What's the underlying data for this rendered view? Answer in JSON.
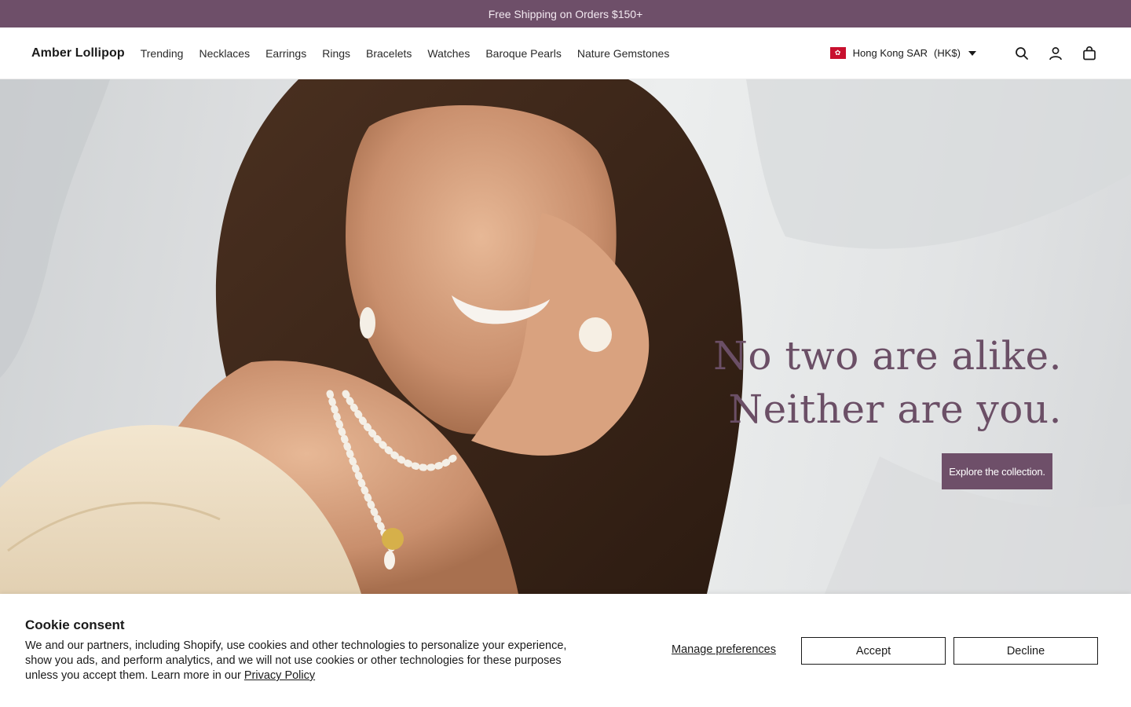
{
  "announcement": {
    "text": "Free Shipping on Orders $150+"
  },
  "header": {
    "logo": "Amber Lollipop",
    "nav": [
      "Trending",
      "Necklaces",
      "Earrings",
      "Rings",
      "Bracelets",
      "Watches",
      "Baroque Pearls",
      "Nature Gemstones"
    ],
    "locale": {
      "region": "Hong Kong SAR",
      "currency": "(HK$)",
      "flag_icon": "hong-kong-flag-icon"
    },
    "icons": [
      "search-icon",
      "account-icon",
      "cart-icon"
    ]
  },
  "hero": {
    "headline_line1": "No two are alike.",
    "headline_line2": "Neither are you.",
    "cta_label": "Explore the collection."
  },
  "cookie": {
    "title": "Cookie consent",
    "body": "We and our partners, including Shopify, use cookies and other technologies to personalize your experience, show you ads, and perform analytics, and we will not use cookies or other technologies for these purposes unless you accept them. Learn more in our",
    "privacy_link": "Privacy Policy",
    "manage_label": "Manage preferences",
    "accept_label": "Accept",
    "decline_label": "Decline"
  },
  "colors": {
    "brand": "#6e4f69",
    "headline": "#6b4f66",
    "text": "#1a1a1a"
  }
}
